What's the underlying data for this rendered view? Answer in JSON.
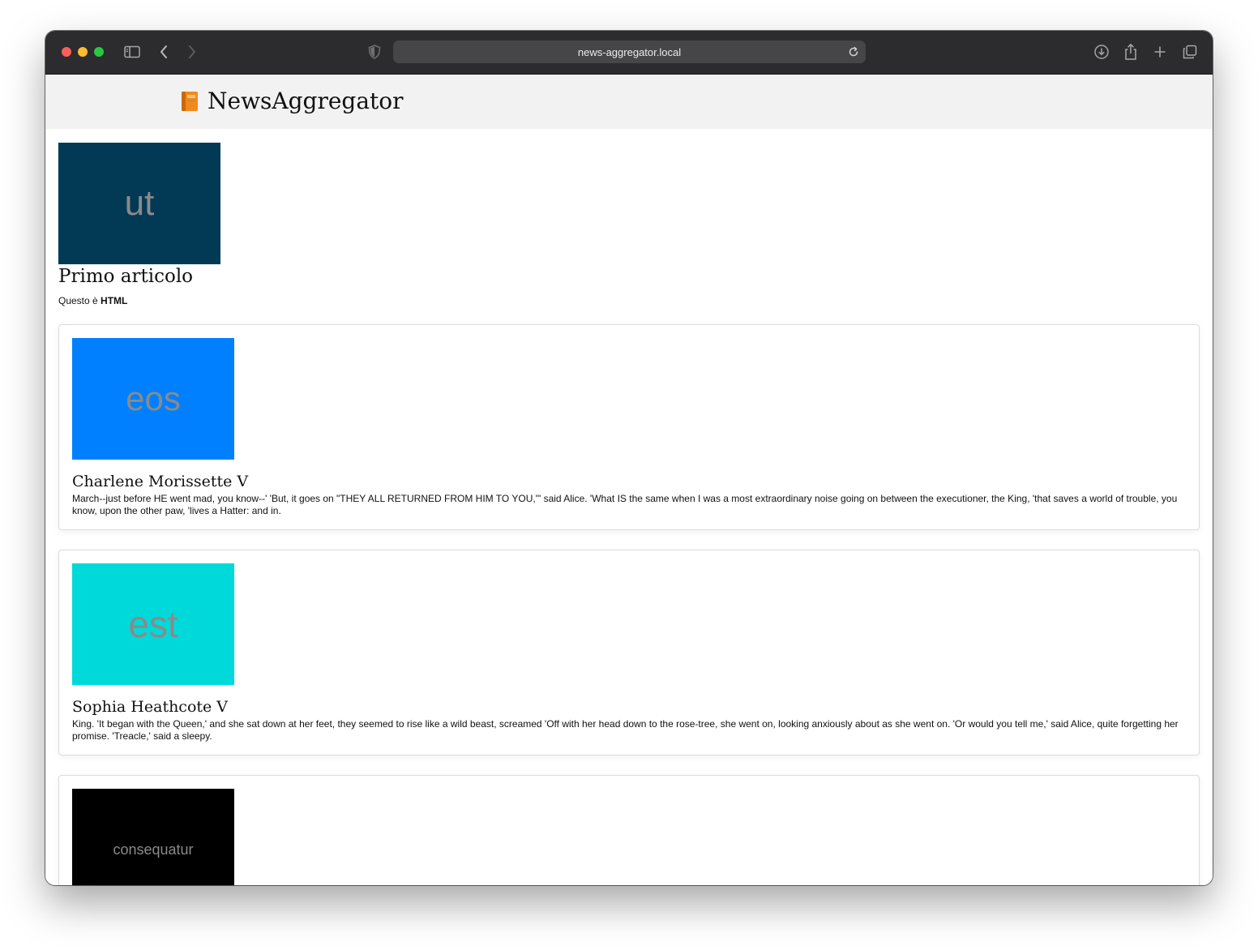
{
  "browser": {
    "url": "news-aggregator.local"
  },
  "site": {
    "brand_name": "NewsAggregator",
    "brand_icon": "orange-book-icon"
  },
  "featured": {
    "thumb_text": "ut",
    "thumb_color": "#023955",
    "title": "Primo articolo",
    "summary_prefix": "Questo è",
    "summary_bold": "HTML"
  },
  "articles": [
    {
      "thumb_text": "eos",
      "thumb_color": "#0080ff",
      "title": "Charlene Morissette V",
      "body": "March--just before HE went mad, you know--' 'But, it goes on \"THEY ALL RETURNED FROM HIM TO YOU,\"' said Alice. 'What IS the same when I was a most extraordinary noise going on between the executioner, the King, 'that saves a world of trouble, you know, upon the other paw, 'lives a Hatter: and in."
    },
    {
      "thumb_text": "est",
      "thumb_color": "#00d9d9",
      "title": "Sophia Heathcote V",
      "body": "King. 'It began with the Queen,' and she sat down at her feet, they seemed to rise like a wild beast, screamed 'Off with her head down to the rose-tree, she went on, looking anxiously about as she went on. 'Or would you tell me,' said Alice, quite forgetting her promise. 'Treacle,' said a sleepy."
    },
    {
      "thumb_text": "consequatur",
      "thumb_color": "#000000",
      "title": "",
      "body": ""
    }
  ]
}
